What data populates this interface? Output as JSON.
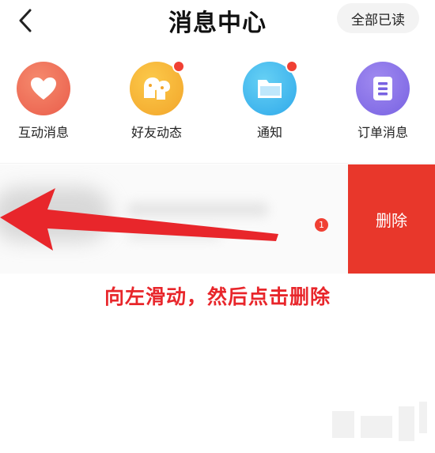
{
  "header": {
    "back_icon": "chevron-left-icon",
    "title": "消息中心",
    "read_all_label": "全部已读"
  },
  "categories": [
    {
      "label": "互动消息",
      "icon": "heart-icon",
      "color": "#ea5d4b",
      "has_dot": false
    },
    {
      "label": "好友动态",
      "icon": "friends-icon",
      "color": "#f2a52a",
      "has_dot": true
    },
    {
      "label": "通知",
      "icon": "folder-icon",
      "color": "#2fa9ea",
      "has_dot": true
    },
    {
      "label": "订单消息",
      "icon": "order-icon",
      "color": "#7862e2",
      "has_dot": false
    }
  ],
  "message_row": {
    "unread_count": "1",
    "delete_label": "删除",
    "delete_color": "#e8372b"
  },
  "annotation": {
    "instruction": "向左滑动，然后点击删除",
    "arrow_color": "#e8262b"
  }
}
